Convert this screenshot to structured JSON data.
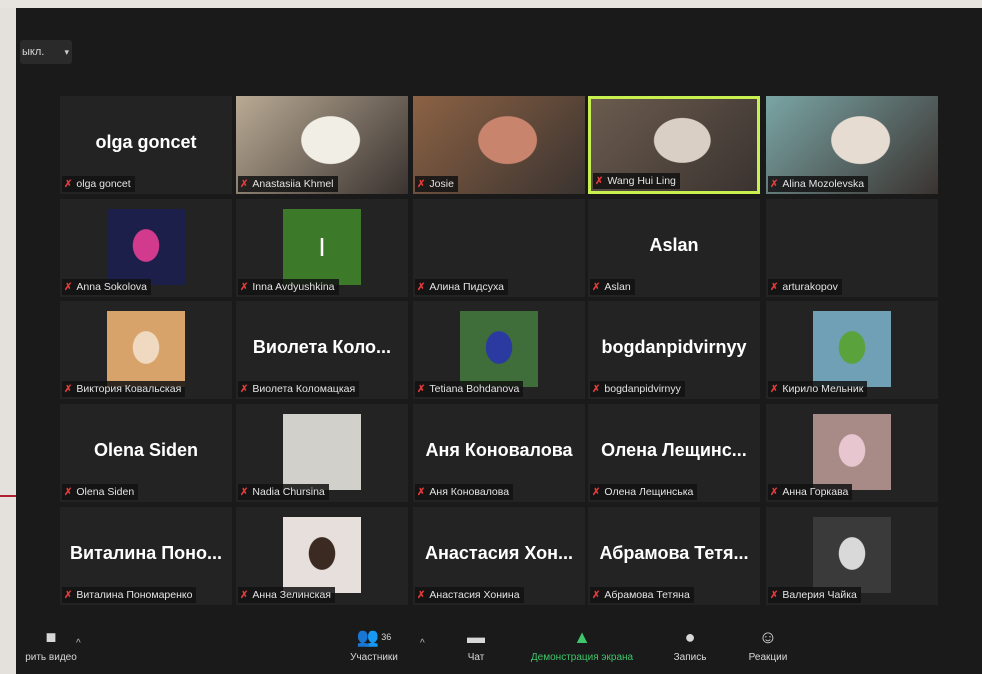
{
  "view_button": {
    "label": "ыкл.",
    "chevron": "▾"
  },
  "tiles": [
    {
      "kind": "name",
      "big": "olga goncet",
      "label": "olga goncet"
    },
    {
      "kind": "video",
      "label": "Anastasiia Khmel",
      "bg": "#b9aa94",
      "accent": "#f1eee6"
    },
    {
      "kind": "video",
      "label": "Josie",
      "bg": "#8c6244",
      "accent": "#c9846d"
    },
    {
      "kind": "video",
      "label": "Wang Hui Ling",
      "bg": "#6b5b4e",
      "accent": "#d9cfc4",
      "active": true
    },
    {
      "kind": "video",
      "label": "Alina Mozolevska",
      "bg": "#7aa5a5",
      "accent": "#e7dcd2"
    },
    {
      "kind": "thumb",
      "label": "Anna Sokolova",
      "bg": "#1c1f4a",
      "accent": "#d23a8e"
    },
    {
      "kind": "thumb",
      "label": "Inna Avdyushkina",
      "bg": "#3c7a2a",
      "accent": "#3c7a2a",
      "big": "I"
    },
    {
      "kind": "empty",
      "label": "Алина Пидсуха"
    },
    {
      "kind": "name",
      "big": "Aslan",
      "label": "Aslan"
    },
    {
      "kind": "empty",
      "label": "arturakopov"
    },
    {
      "kind": "thumb",
      "label": "Виктория Ковальская",
      "bg": "#d8a36a",
      "accent": "#f0d9c1"
    },
    {
      "kind": "name",
      "big": "Виолета Коло...",
      "label": "Виолета Коломацкая"
    },
    {
      "kind": "thumb",
      "label": "Tetiana Bohdanova",
      "bg": "#3f6e3a",
      "accent": "#2a3aa0"
    },
    {
      "kind": "name",
      "big": "bogdanpidvirnyy",
      "label": "bogdanpidvirnyy"
    },
    {
      "kind": "thumb",
      "label": "Кирило Мельник",
      "bg": "#6fa0b6",
      "accent": "#5aa33c"
    },
    {
      "kind": "name",
      "big": "Olena Siden",
      "label": "Olena Siden"
    },
    {
      "kind": "thumb",
      "label": "Nadia Chursina",
      "bg": "#d2d0cb",
      "accent": "#d2d0cb"
    },
    {
      "kind": "name",
      "big": "Аня Коновалова",
      "label": "Аня Коновалова"
    },
    {
      "kind": "name",
      "big": "Олена Лещинс...",
      "label": "Олена Лещинська"
    },
    {
      "kind": "thumb",
      "label": "Анна Горкава",
      "bg": "#a88a86",
      "accent": "#e7c6cf"
    },
    {
      "kind": "name",
      "big": "Виталина Поно...",
      "label": "Виталина Пономаренко"
    },
    {
      "kind": "thumb",
      "label": "Анна Зелинская",
      "bg": "#e6dfdb",
      "accent": "#3a2a22"
    },
    {
      "kind": "name",
      "big": "Анастасия Хон...",
      "label": "Анастасия Хонина"
    },
    {
      "kind": "name",
      "big": "Абрамова Тетя...",
      "label": "Абрамова Тетяна"
    },
    {
      "kind": "thumb",
      "label": "Валерия Чайка",
      "bg": "#3a3a3a",
      "accent": "#d9d9d9"
    }
  ],
  "toolbar": {
    "video_label": "рить видео",
    "participants_label": "Участники",
    "participants_count": "36",
    "chat_label": "Чат",
    "share_label": "Демонстрация экрана",
    "record_label": "Запись",
    "reactions_label": "Реакции"
  },
  "icons": {
    "mic_muted": "✗",
    "video": "■",
    "participants": "👥",
    "chat": "▬",
    "share": "▲",
    "record": "●",
    "reactions": "☺",
    "caret_up": "^"
  },
  "colors": {
    "active_border": "#c8f150",
    "share_green": "#3fc56a",
    "muted_red": "#e33a3a",
    "accent_red": "#b21e32"
  }
}
